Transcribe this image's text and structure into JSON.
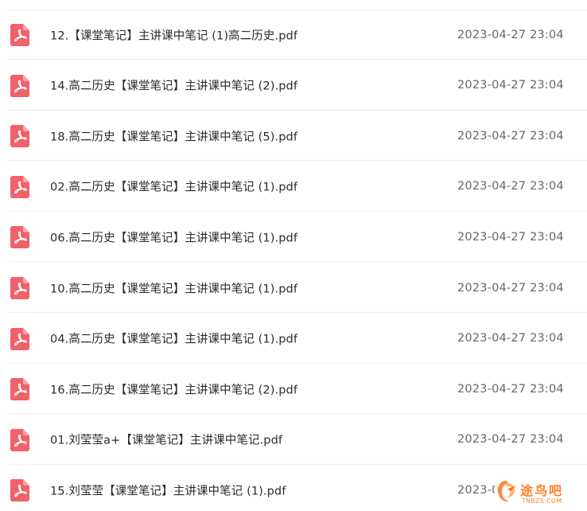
{
  "files": [
    {
      "name": "12.【课堂笔记】主讲课中笔记 (1)高二历史.pdf",
      "date": "2023-04-27 23:04",
      "icon": "pdf-icon"
    },
    {
      "name": "14.高二历史【课堂笔记】主讲课中笔记 (2).pdf",
      "date": "2023-04-27 23:04",
      "icon": "pdf-icon"
    },
    {
      "name": "18.高二历史【课堂笔记】主讲课中笔记 (5).pdf",
      "date": "2023-04-27 23:04",
      "icon": "pdf-icon"
    },
    {
      "name": "02.高二历史【课堂笔记】主讲课中笔记 (1).pdf",
      "date": "2023-04-27 23:04",
      "icon": "pdf-icon"
    },
    {
      "name": "06.高二历史【课堂笔记】主讲课中笔记 (1).pdf",
      "date": "2023-04-27 23:04",
      "icon": "pdf-icon"
    },
    {
      "name": "10.高二历史【课堂笔记】主讲课中笔记 (1).pdf",
      "date": "2023-04-27 23:04",
      "icon": "pdf-icon"
    },
    {
      "name": "04.高二历史【课堂笔记】主讲课中笔记 (1).pdf",
      "date": "2023-04-27 23:04",
      "icon": "pdf-icon"
    },
    {
      "name": "16.高二历史【课堂笔记】主讲课中笔记 (2).pdf",
      "date": "2023-04-27 23:04",
      "icon": "pdf-icon"
    },
    {
      "name": "01.刘莹莹a+【课堂笔记】主讲课中笔记.pdf",
      "date": "2023-04-27 23:04",
      "icon": "pdf-icon"
    },
    {
      "name": "15.刘莹莹【课堂笔记】主讲课中笔记 (1).pdf",
      "date": "2023-04",
      "icon": "pdf-icon"
    }
  ],
  "watermark": {
    "text": "途鸟吧",
    "subtext": "TNBZS.COM",
    "color": "#ff7f2a"
  },
  "colors": {
    "pdf_icon": "#f0616a",
    "divider": "#ececec",
    "name_text": "#2b2b2b",
    "date_text": "#666666"
  }
}
